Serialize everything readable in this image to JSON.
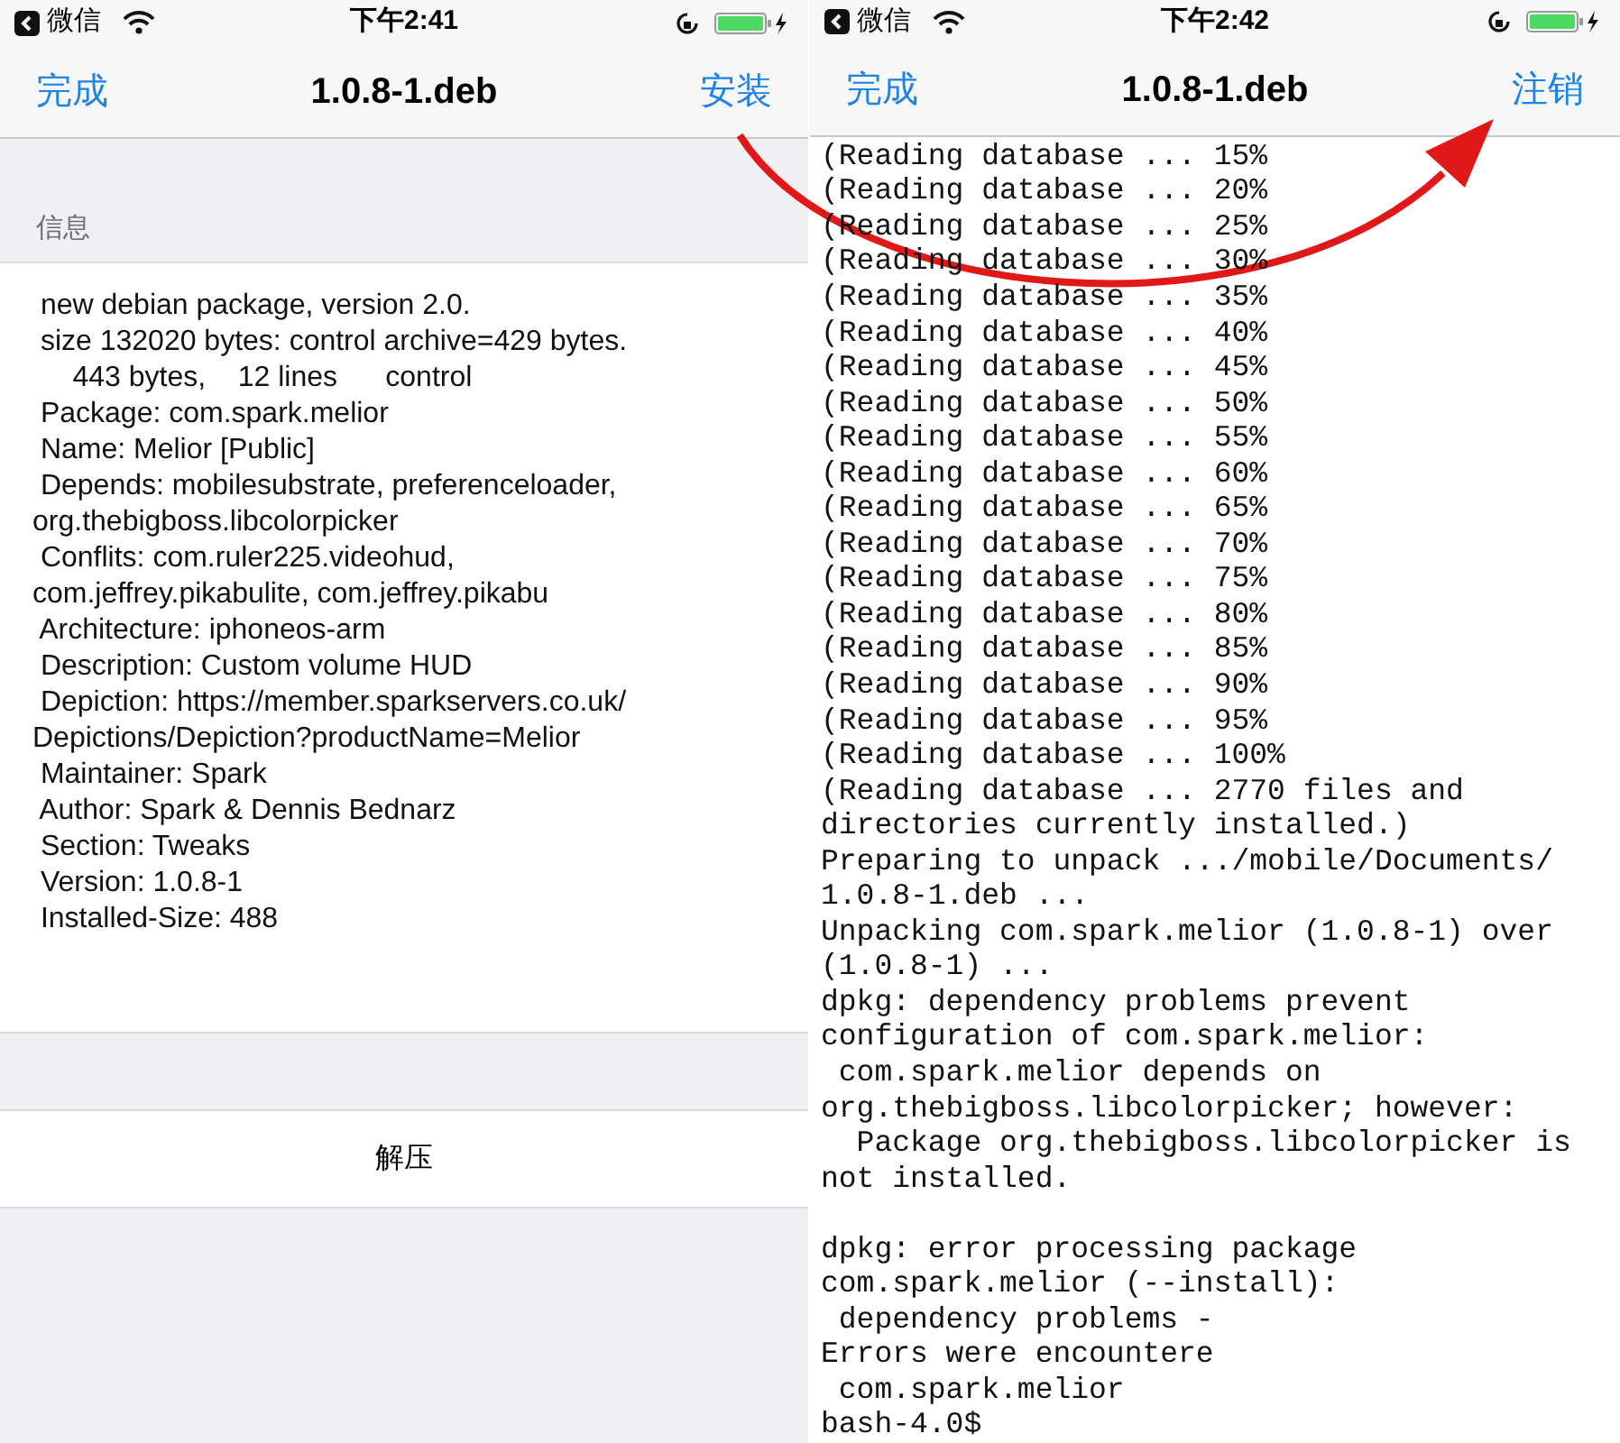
{
  "left_screen": {
    "status_bar": {
      "back_app": "微信",
      "time": "下午2:41"
    },
    "nav_bar": {
      "left": "完成",
      "title": "1.0.8-1.deb",
      "right": "安装"
    },
    "section_header": "信息",
    "info_lines": [
      " new debian package, version 2.0.",
      " size 132020 bytes: control archive=429 bytes.",
      "     443 bytes,    12 lines      control",
      " Package: com.spark.melior",
      " Name: Melior [Public]",
      " Depends: mobilesubstrate, preferenceloader,",
      "org.thebigboss.libcolorpicker",
      " Conflits: com.ruler225.videohud,",
      "com.jeffrey.pikabulite, com.jeffrey.pikabu",
      " Architecture: iphoneos-arm",
      " Description: Custom volume HUD",
      " Depiction: https://member.sparkservers.co.uk/",
      "Depictions/Depiction?productName=Melior",
      " Maintainer: Spark",
      " Author: Spark & Dennis Bednarz",
      " Section: Tweaks",
      " Version: 1.0.8-1",
      " Installed-Size: 488"
    ],
    "action_button": "解压"
  },
  "right_screen": {
    "status_bar": {
      "back_app": "微信",
      "time": "下午2:42"
    },
    "nav_bar": {
      "left": "完成",
      "title": "1.0.8-1.deb",
      "right": "注销"
    },
    "terminal_blocks": [
      [
        "(Reading database ... 15%",
        "(Reading database ... 20%",
        "(Reading database ... 25%",
        "(Reading database ... 30%",
        "(Reading database ... 35%",
        "(Reading database ... 40%",
        "(Reading database ... 45%",
        "(Reading database ... 50%",
        "(Reading database ... 55%",
        "(Reading database ... 60%",
        "(Reading database ... 65%",
        "(Reading database ... 70%",
        "(Reading database ... 75%",
        "(Reading database ... 80%",
        "(Reading database ... 85%",
        "(Reading database ... 90%",
        "(Reading database ... 95%",
        "(Reading database ... 100%",
        "(Reading database ... 2770 files and",
        "directories currently installed.)",
        "Preparing to unpack .../mobile/Documents/",
        "1.0.8-1.deb ...",
        "Unpacking com.spark.melior (1.0.8-1) over",
        "(1.0.8-1) ...",
        "dpkg: dependency problems prevent",
        "configuration of com.spark.melior:",
        " com.spark.melior depends on",
        "org.thebigboss.libcolorpicker; however:",
        "  Package org.thebigboss.libcolorpicker is",
        "not installed."
      ],
      [
        "dpkg: error processing package",
        "com.spark.melior (--install):",
        " dependency problems -",
        "Errors were encountere",
        " com.spark.melior",
        "bash-4.0$"
      ]
    ]
  }
}
